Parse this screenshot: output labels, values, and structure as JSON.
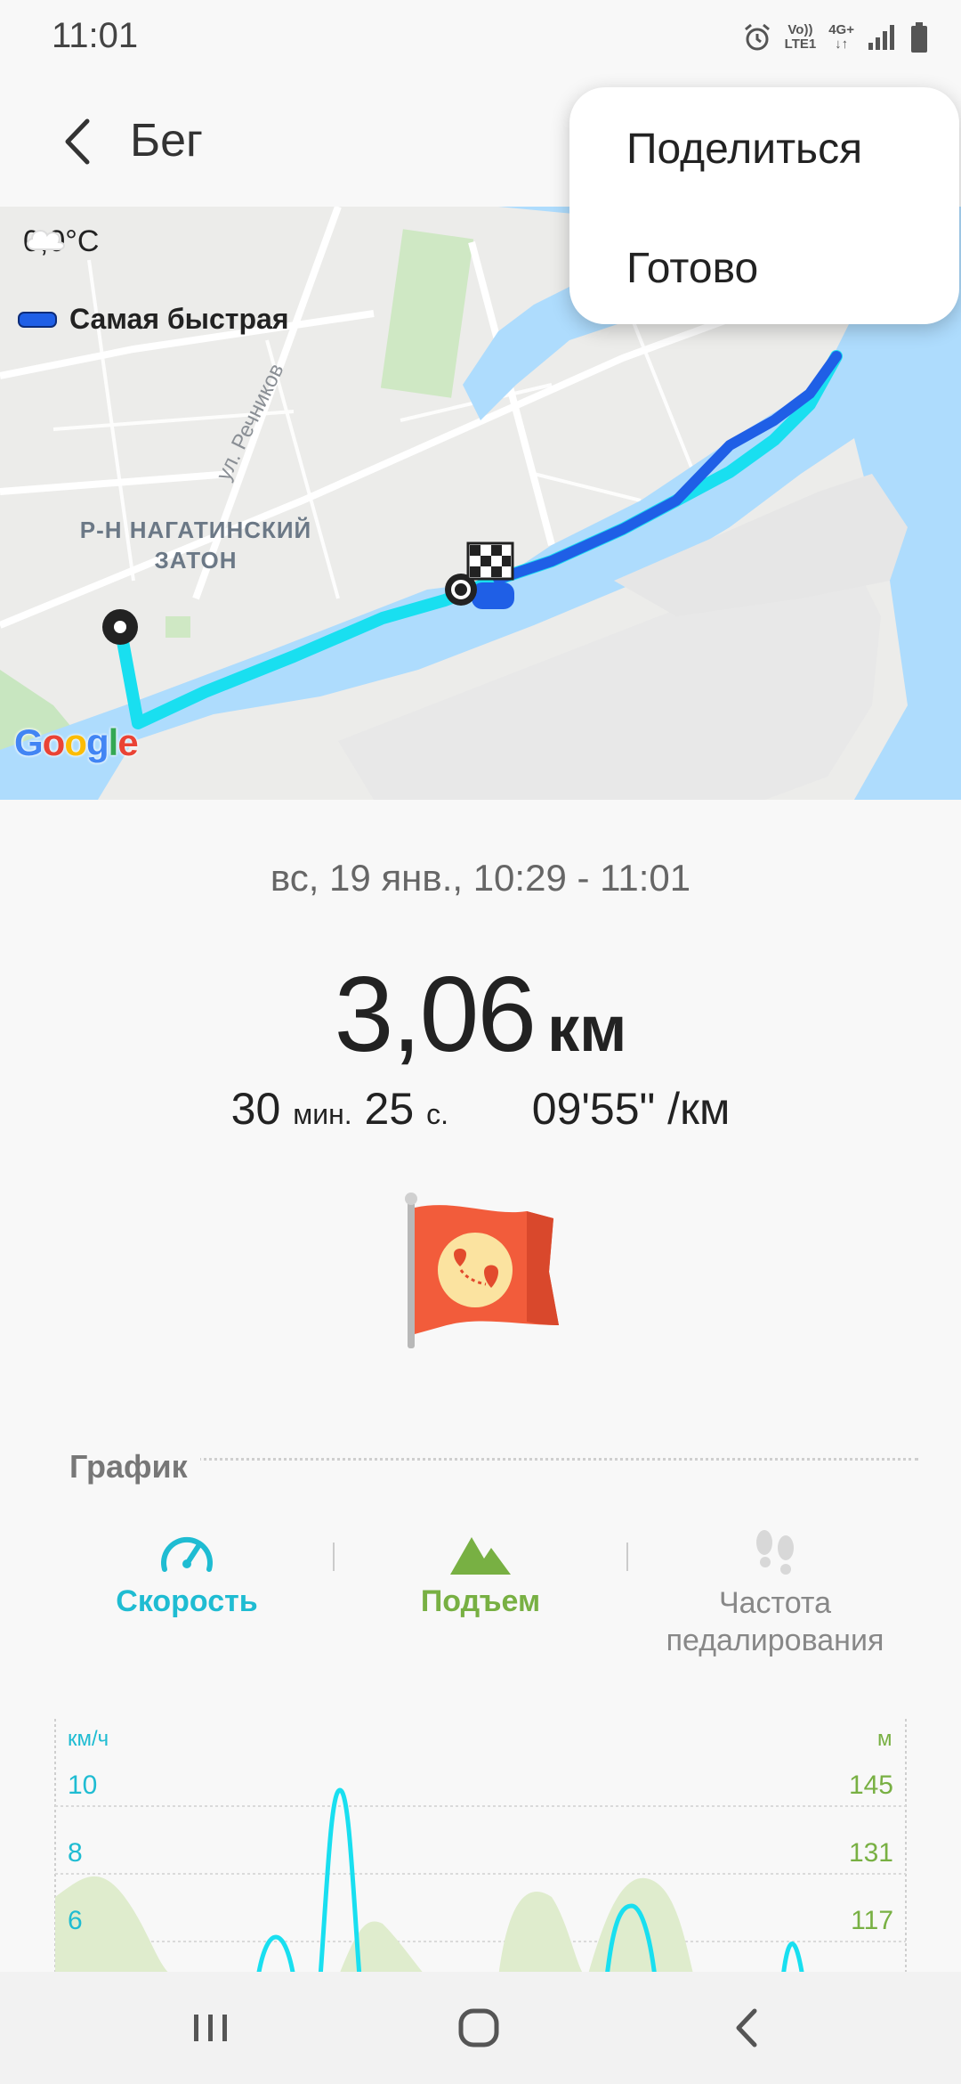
{
  "status_bar": {
    "time": "11:01",
    "volte_label_top": "Vo))",
    "volte_label_bottom": "LTE1",
    "network_label": "4G+"
  },
  "app_bar": {
    "title": "Бег"
  },
  "menu": {
    "share": "Поделиться",
    "done": "Готово"
  },
  "map": {
    "weather": "0,0°C",
    "legend": "Самая быстрая",
    "district_line1": "Р-Н НАГАТИНСКИЙ",
    "district_line2": "ЗАТОН",
    "street": "ул. Речников",
    "google": [
      "G",
      "o",
      "o",
      "g",
      "l",
      "e"
    ],
    "route_fast_color": "#1f5fe6",
    "route_color": "#19dff0"
  },
  "summary": {
    "date_range": "вс, 19 янв., 10:29 - 11:01",
    "distance_value": "3,06",
    "distance_unit": "км",
    "duration_min": "30",
    "min_label": "мин.",
    "duration_sec": "25",
    "sec_label": "с.",
    "pace": "09'55\" /км"
  },
  "graph": {
    "title": "График",
    "tabs": {
      "speed": "Скорость",
      "climb": "Подъем",
      "cadence_line1": "Частота",
      "cadence_line2": "педалирования"
    }
  },
  "chart_data": {
    "type": "line",
    "left_axis_unit": "км/ч",
    "right_axis_unit": "м",
    "left_ticks": [
      "10",
      "8",
      "6"
    ],
    "right_ticks": [
      "145",
      "131",
      "117"
    ],
    "speed_color": "#19dff0",
    "elevation_color": "#dfeccd"
  }
}
